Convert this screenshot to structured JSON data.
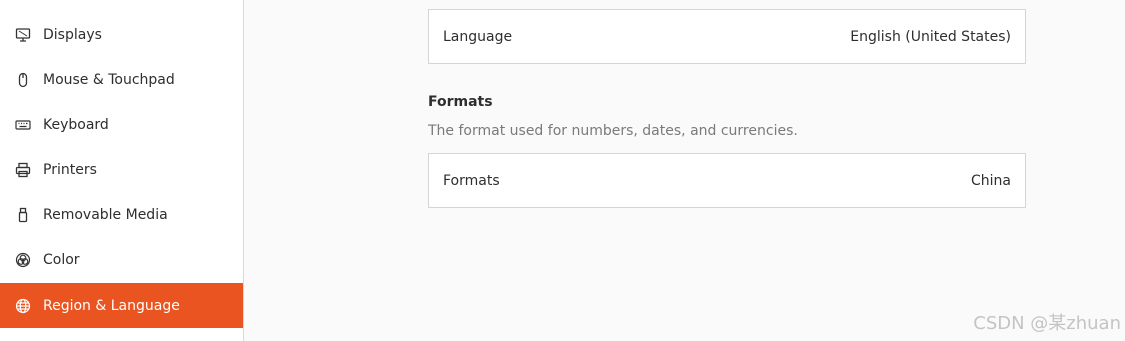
{
  "sidebar": {
    "items": [
      {
        "label": "Displays",
        "icon": "display-icon"
      },
      {
        "label": "Mouse & Touchpad",
        "icon": "mouse-icon"
      },
      {
        "label": "Keyboard",
        "icon": "keyboard-icon"
      },
      {
        "label": "Printers",
        "icon": "printer-icon"
      },
      {
        "label": "Removable Media",
        "icon": "usb-drive-icon"
      },
      {
        "label": "Color",
        "icon": "color-icon"
      },
      {
        "label": "Region & Language",
        "icon": "globe-icon",
        "active": true
      }
    ]
  },
  "language_row": {
    "label": "Language",
    "value": "English (United States)"
  },
  "formats_section": {
    "title": "Formats",
    "description": "The format used for numbers, dates, and currencies."
  },
  "formats_row": {
    "label": "Formats",
    "value": "China"
  },
  "watermark": "CSDN @某zhuan",
  "colors": {
    "accent": "#e95420",
    "background": "#fafafa"
  }
}
